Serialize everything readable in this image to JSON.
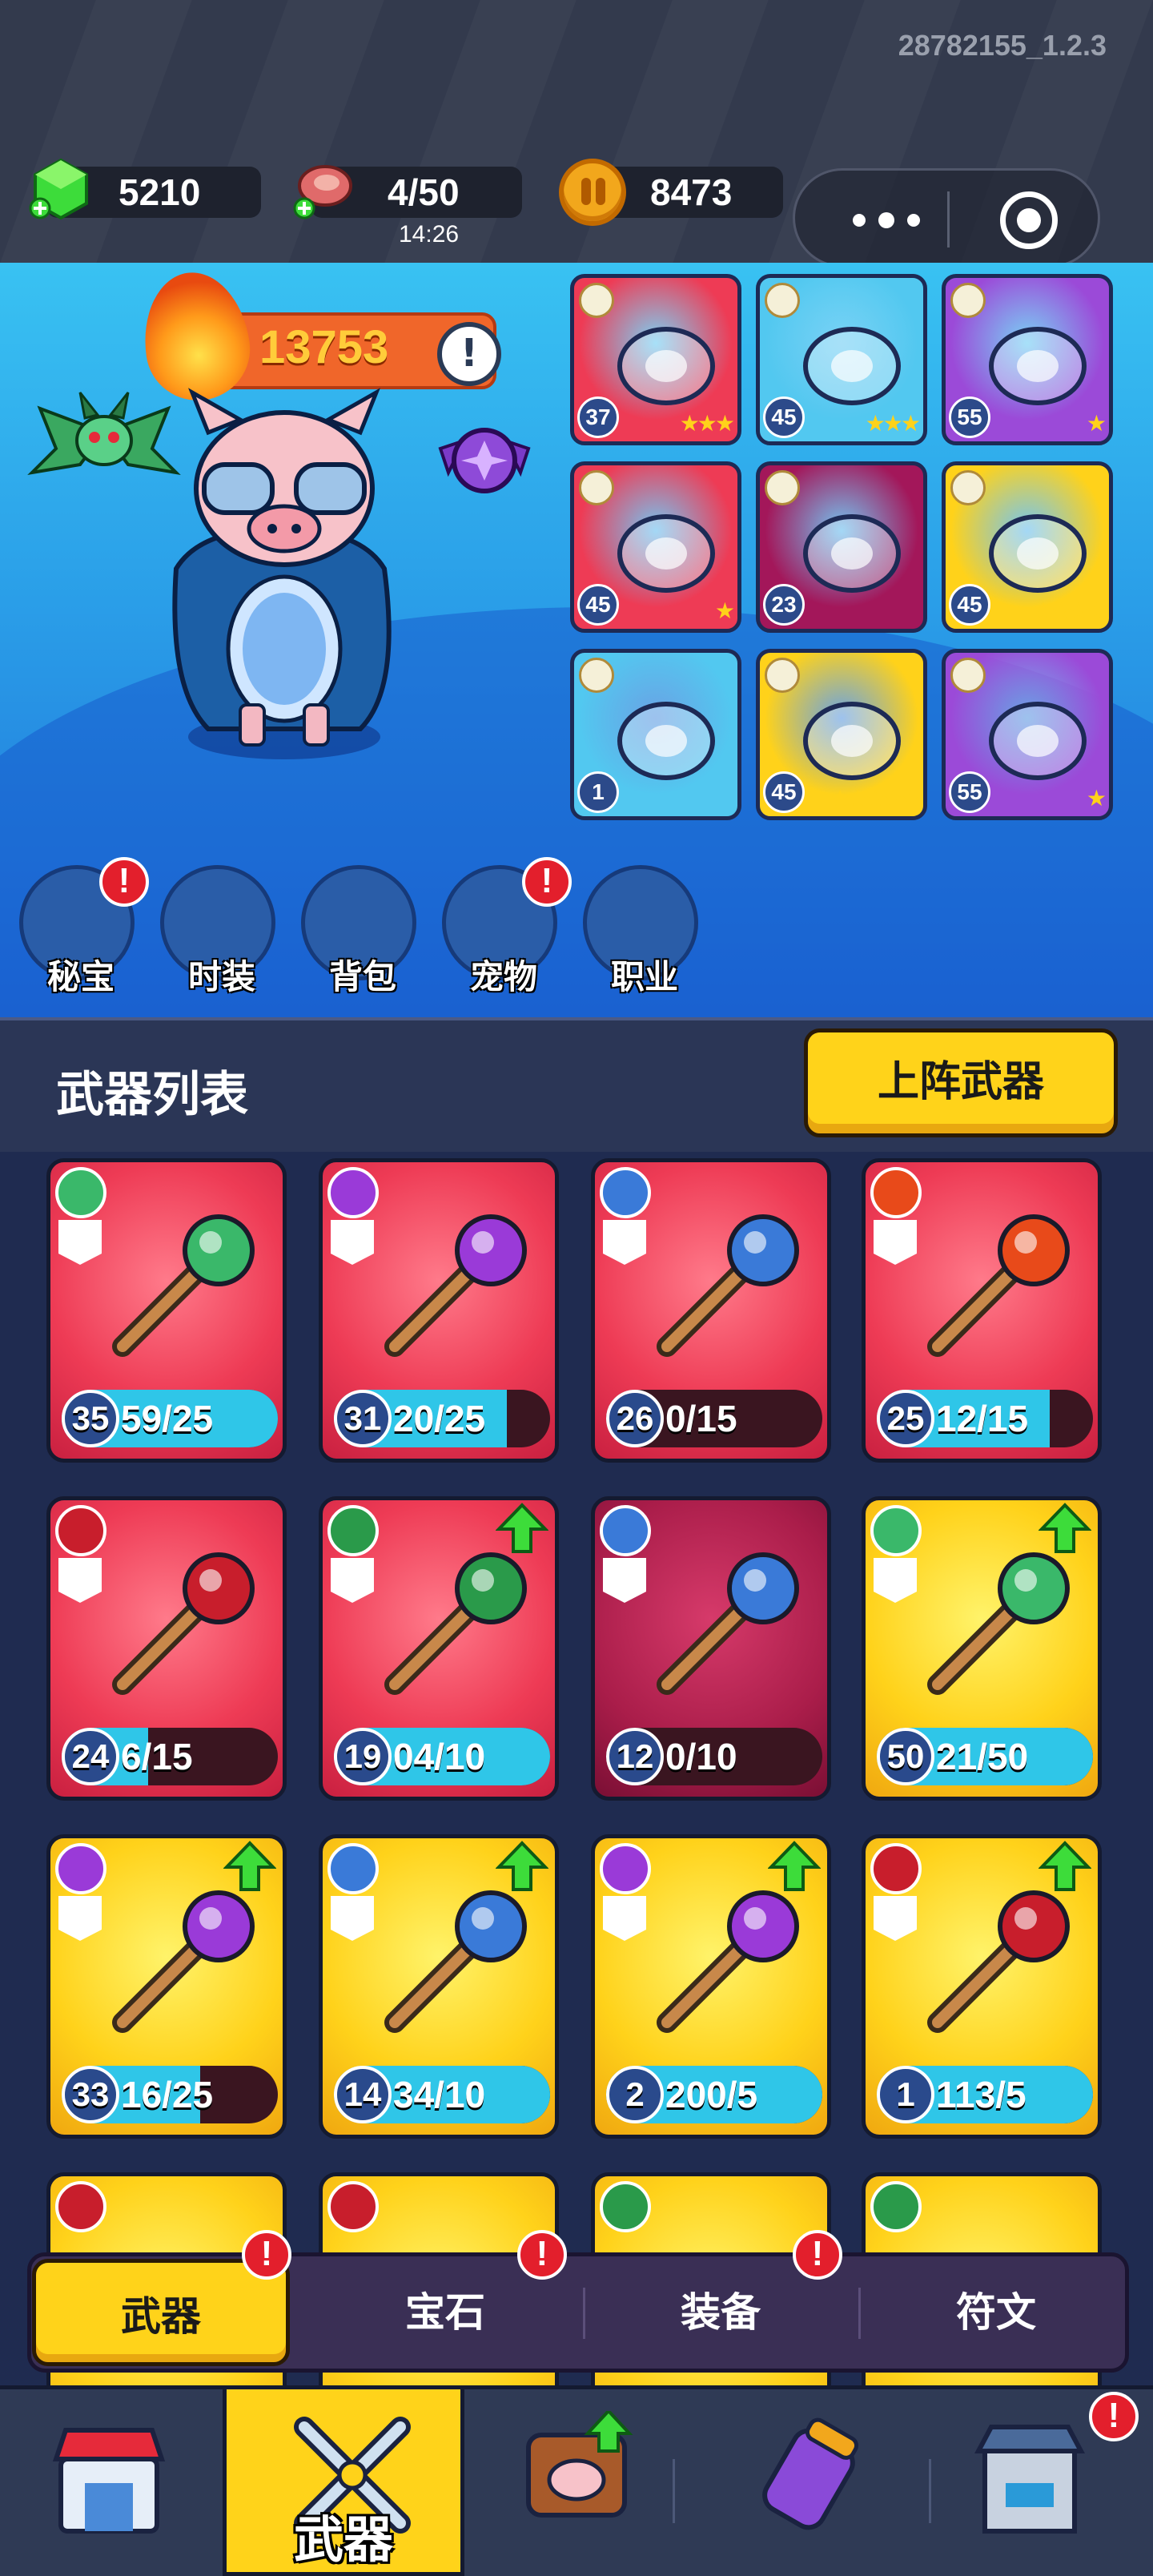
{
  "version": "28782155_1.2.3",
  "resources": {
    "gems": "5210",
    "stamina": "4/50",
    "stamina_timer": "14:26",
    "coins": "8473"
  },
  "hero": {
    "power": "13753",
    "info_label": "!",
    "equipment": [
      {
        "level": "37",
        "stars": "★★★",
        "color": "#ee3b55",
        "item": "collar"
      },
      {
        "level": "45",
        "stars": "★★★",
        "color": "#52c8f0",
        "item": "gloves"
      },
      {
        "level": "55",
        "stars": "★",
        "color": "#9b4ad8",
        "item": "disc"
      },
      {
        "level": "45",
        "stars": "★",
        "color": "#ee3b55",
        "item": "crystal-scepter"
      },
      {
        "level": "23",
        "stars": "",
        "color": "#a3175a",
        "item": "dark-spear"
      },
      {
        "level": "45",
        "stars": "★★★★",
        "color": "#ffd21a",
        "item": "purple-boots"
      },
      {
        "level": "1",
        "stars": "",
        "color": "#52c8f0",
        "item": "potion-vial"
      },
      {
        "level": "45",
        "stars": "★★★★★",
        "color": "#ffd21a",
        "item": "bell-helmet"
      },
      {
        "level": "55",
        "stars": "★",
        "color": "#9b4ad8",
        "item": "horn"
      }
    ]
  },
  "side_menu": [
    {
      "label": "秘宝",
      "alert": true,
      "icon": "treasure-pot-icon"
    },
    {
      "label": "时装",
      "alert": false,
      "icon": "hat-icon"
    },
    {
      "label": "背包",
      "alert": false,
      "icon": "robot-backpack-icon"
    },
    {
      "label": "宠物",
      "alert": true,
      "icon": "paw-icon"
    },
    {
      "label": "职业",
      "alert": false,
      "icon": "sword-class-icon"
    }
  ],
  "weapon_list": {
    "title": "武器列表",
    "deploy_button": "上阵武器",
    "weapons": [
      {
        "level": "35",
        "progress": "59/25",
        "fill": 1.0,
        "rarity": "red",
        "element": "wind",
        "weapon": "spellbook"
      },
      {
        "level": "31",
        "progress": "20/25",
        "fill": 0.8,
        "rarity": "red",
        "element": "lightning",
        "weapon": "boomerang"
      },
      {
        "level": "26",
        "progress": "0/15",
        "fill": 0.0,
        "rarity": "red",
        "element": "ice",
        "weapon": "ice-pick"
      },
      {
        "level": "25",
        "progress": "12/15",
        "fill": 0.8,
        "rarity": "red",
        "element": "fire",
        "weapon": "axe"
      },
      {
        "level": "24",
        "progress": "6/15",
        "fill": 0.4,
        "rarity": "red",
        "element": "physical",
        "weapon": "crossbow"
      },
      {
        "level": "19",
        "progress": "04/10",
        "fill": 1.0,
        "rarity": "red",
        "element": "poison",
        "weapon": "catapult"
      },
      {
        "level": "12",
        "progress": "0/10",
        "fill": 0.0,
        "rarity": "dark",
        "element": "ice",
        "weapon": "scythe"
      },
      {
        "level": "50",
        "progress": "21/50",
        "fill": 1.0,
        "rarity": "gold",
        "element": "wind",
        "weapon": "feather-staff"
      },
      {
        "level": "33",
        "progress": "16/25",
        "fill": 0.64,
        "rarity": "gold",
        "element": "lightning",
        "weapon": "battery-launcher"
      },
      {
        "level": "14",
        "progress": "34/10",
        "fill": 1.0,
        "rarity": "gold",
        "element": "ice",
        "weapon": "ice-crystal"
      },
      {
        "level": "2",
        "progress": "200/5",
        "fill": 1.0,
        "rarity": "gold",
        "element": "lightning",
        "weapon": "orb-staff"
      },
      {
        "level": "1",
        "progress": "113/5",
        "fill": 1.0,
        "rarity": "gold",
        "element": "physical",
        "weapon": "hammer"
      }
    ]
  },
  "tabs": [
    {
      "label": "武器",
      "active": true,
      "alert": true
    },
    {
      "label": "宝石",
      "active": false,
      "alert": true
    },
    {
      "label": "装备",
      "active": false,
      "alert": true
    },
    {
      "label": "符文",
      "active": false,
      "alert": false
    }
  ],
  "bottom_nav": {
    "active_label": "武器",
    "items": [
      "shop-icon",
      "crossed-swords-icon",
      "weapon-chest-icon",
      "battery-icon",
      "blacksmith-icon"
    ]
  },
  "colors": {
    "accent_yellow": "#ffd31a",
    "alert_red": "#e31f2c",
    "progress_cyan": "#2fc6e8"
  }
}
